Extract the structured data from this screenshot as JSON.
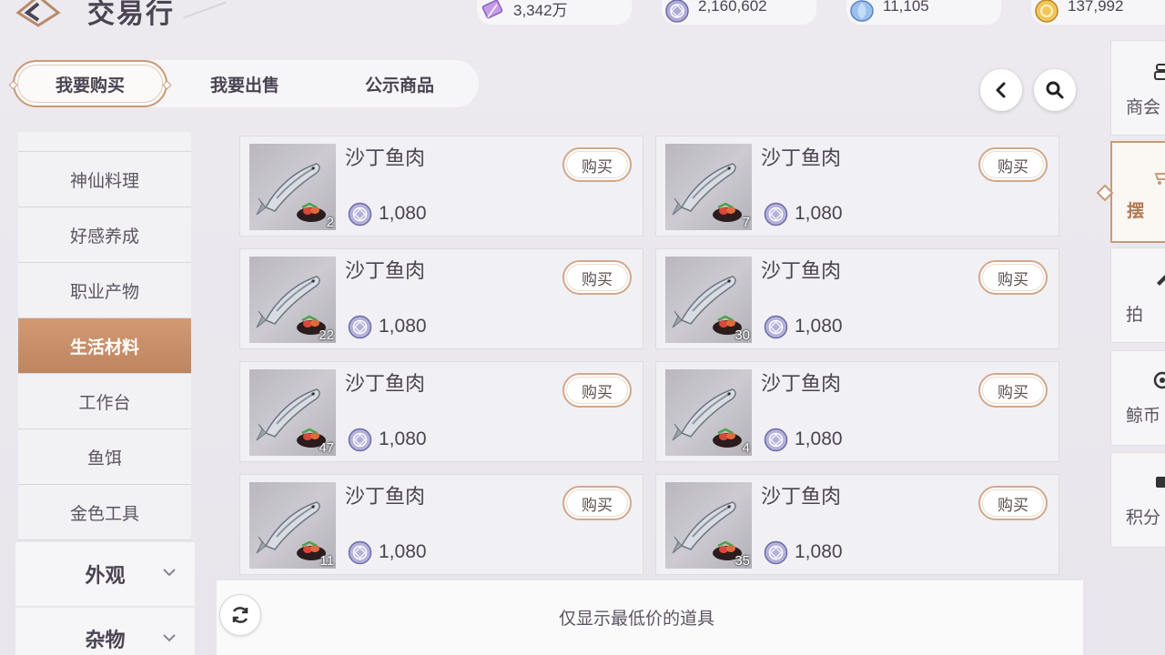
{
  "header": {
    "title": "交易行",
    "currencies": [
      {
        "icon": "purple-ticket-icon",
        "value": "3,342万",
        "color": "#b68ce0"
      },
      {
        "icon": "silver-coin-icon",
        "value": "2,160,602",
        "color": "#8f8cc8"
      },
      {
        "icon": "blue-shell-icon",
        "value": "11,105",
        "color": "#7fa8e0"
      },
      {
        "icon": "gold-coin-icon",
        "value": "137,992",
        "color": "#e0b04a"
      }
    ]
  },
  "tabs": [
    {
      "label": "我要购买",
      "active": true
    },
    {
      "label": "我要出售",
      "active": false
    },
    {
      "label": "公示商品",
      "active": false
    }
  ],
  "categories": {
    "items": [
      {
        "label": "神仙料理",
        "active": false
      },
      {
        "label": "好感养成",
        "active": false
      },
      {
        "label": "职业产物",
        "active": false
      },
      {
        "label": "生活材料",
        "active": true
      },
      {
        "label": "工作台",
        "active": false
      },
      {
        "label": "鱼饵",
        "active": false
      },
      {
        "label": "金色工具",
        "active": false
      }
    ],
    "groups": [
      {
        "label": "外观"
      },
      {
        "label": "杂物"
      }
    ]
  },
  "listings": [
    {
      "name": "沙丁鱼肉",
      "qty": "2",
      "price": "1,080",
      "buy_label": "购买"
    },
    {
      "name": "沙丁鱼肉",
      "qty": "7",
      "price": "1,080",
      "buy_label": "购买"
    },
    {
      "name": "沙丁鱼肉",
      "qty": "22",
      "price": "1,080",
      "buy_label": "购买"
    },
    {
      "name": "沙丁鱼肉",
      "qty": "30",
      "price": "1,080",
      "buy_label": "购买"
    },
    {
      "name": "沙丁鱼肉",
      "qty": "47",
      "price": "1,080",
      "buy_label": "购买"
    },
    {
      "name": "沙丁鱼肉",
      "qty": "4",
      "price": "1,080",
      "buy_label": "购买"
    },
    {
      "name": "沙丁鱼肉",
      "qty": "11",
      "price": "1,080",
      "buy_label": "购买"
    },
    {
      "name": "沙丁鱼肉",
      "qty": "35",
      "price": "1,080",
      "buy_label": "购买"
    }
  ],
  "footer": {
    "note": "仅显示最低价的道具"
  },
  "side_panel": [
    {
      "label": "商会",
      "icon": "guild-icon",
      "active": false
    },
    {
      "label": "摆",
      "icon": "stall-icon",
      "active": true
    },
    {
      "label": "拍",
      "icon": "auction-icon",
      "active": false
    },
    {
      "label": "鲸币",
      "icon": "whale-coin-icon",
      "active": false
    },
    {
      "label": "积分",
      "icon": "points-icon",
      "active": false
    }
  ]
}
